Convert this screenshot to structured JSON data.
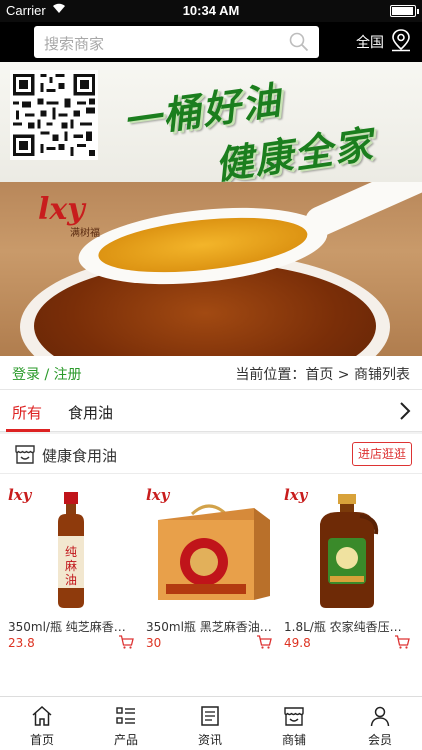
{
  "status_bar": {
    "carrier": "Carrier",
    "time": "10:34 AM"
  },
  "header": {
    "search_placeholder": "搜索商家",
    "region_label": "全国"
  },
  "banner": {
    "slogan_line1": "一桶好油",
    "slogan_line2": "健康全家",
    "brand_logo": "lxy",
    "brand_sub": "满树福"
  },
  "breadcrumb": {
    "login": "登录",
    "separator": "/",
    "register": "注册",
    "location_text": "当前位置：首页 > 商铺列表"
  },
  "tabs": [
    {
      "label": "所有",
      "active": true
    },
    {
      "label": "食用油",
      "active": false
    }
  ],
  "shop": {
    "name": "健康食用油",
    "enter_label": "进店逛逛",
    "products": [
      {
        "name": "350ml/瓶 纯芝麻香油…",
        "price": "23.8",
        "image": "sesame-oil-bottle"
      },
      {
        "name": "350ml瓶 黑芝麻香油 …",
        "price": "30",
        "image": "gift-box"
      },
      {
        "name": "1.8L/瓶 农家纯香压…",
        "price": "49.8",
        "image": "oil-jug"
      }
    ]
  },
  "bottom_nav": [
    {
      "label": "首页",
      "icon": "home-icon"
    },
    {
      "label": "产品",
      "icon": "list-icon"
    },
    {
      "label": "资讯",
      "icon": "news-icon"
    },
    {
      "label": "商铺",
      "icon": "store-icon"
    },
    {
      "label": "会员",
      "icon": "user-icon"
    }
  ],
  "colors": {
    "accent": "#dd2222",
    "link_green": "#2a9a2a",
    "header_bg": "#000000"
  }
}
